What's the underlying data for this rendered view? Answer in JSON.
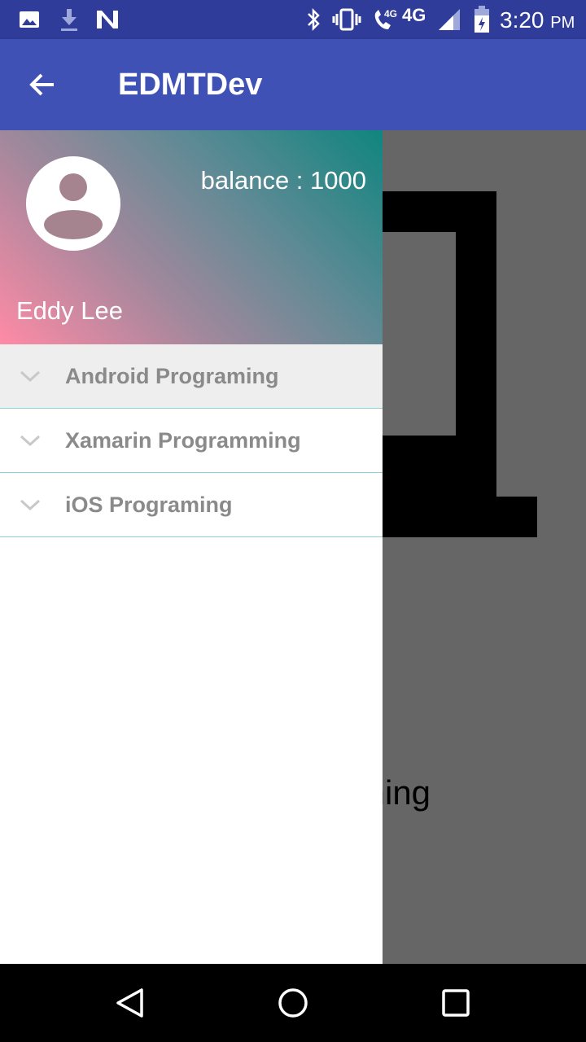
{
  "status_bar": {
    "time": "3:20",
    "ampm": "PM",
    "network_label": "4G",
    "call_network_label": "4G",
    "icons": [
      "image-icon",
      "download-icon",
      "n-icon",
      "bluetooth-icon",
      "vibrate-icon",
      "wifi-call-icon",
      "signal-icon",
      "battery-icon"
    ]
  },
  "app_bar": {
    "title": "EDMTDev",
    "back_icon": "arrow-back-icon"
  },
  "content": {
    "caption_partial": "ming"
  },
  "drawer": {
    "balance": "balance : 1000",
    "user_name": "Eddy Lee",
    "avatar_icon": "account-circle-icon",
    "items": [
      {
        "label": "Android Programing",
        "selected": true
      },
      {
        "label": "Xamarin Programming",
        "selected": false
      },
      {
        "label": "iOS Programing",
        "selected": false
      }
    ]
  },
  "nav_bar": {
    "icons": [
      "back-triangle-icon",
      "home-circle-icon",
      "recents-square-icon"
    ]
  },
  "colors": {
    "status_bar": "#2f3c99",
    "app_bar": "#3f51b5",
    "header_gradient_start": "#ff8aa6",
    "header_gradient_end": "#10857f",
    "menu_text": "#8a8a8a",
    "divider": "#8fd0d0"
  }
}
